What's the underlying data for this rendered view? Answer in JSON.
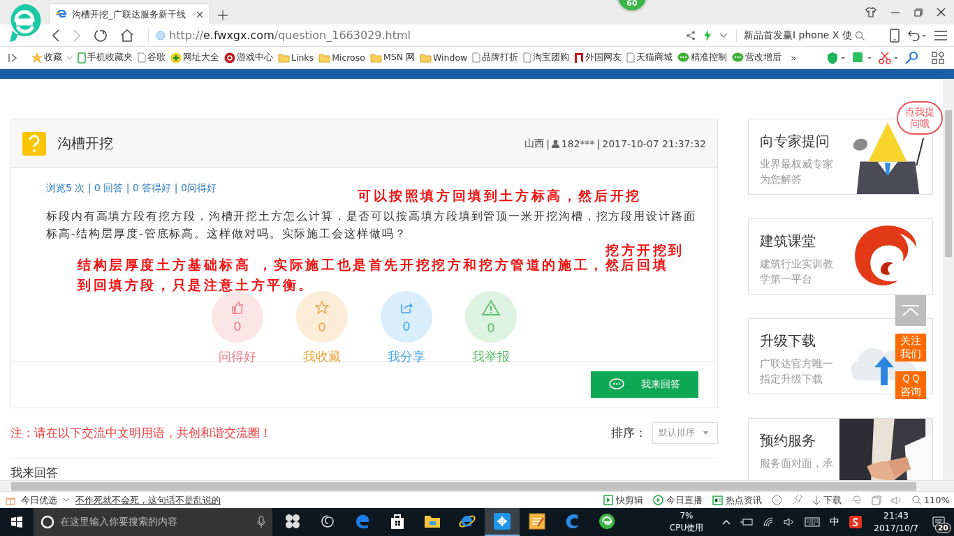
{
  "browser": {
    "tab_title": "沟槽开挖_广联达服务新干线",
    "badge": "60",
    "url": {
      "scheme": "http://",
      "host": "e.fwxgx.com",
      "path": "/question_1663029.html"
    },
    "search": "新品首发赢I phone X 使",
    "bookmarks": [
      {
        "kind": "star",
        "label": "收藏"
      },
      {
        "kind": "phone",
        "label": "手机收藏夹"
      },
      {
        "kind": "page",
        "label": "谷歌"
      },
      {
        "kind": "plus",
        "label": "网址大全"
      },
      {
        "kind": "game",
        "label": "游戏中心"
      },
      {
        "kind": "folder",
        "label": "Links"
      },
      {
        "kind": "folder",
        "label": "Microso"
      },
      {
        "kind": "folder",
        "label": "MSN 网"
      },
      {
        "kind": "folder",
        "label": "Window"
      },
      {
        "kind": "page",
        "label": "品牌打折"
      },
      {
        "kind": "page",
        "label": "淘宝团购"
      },
      {
        "kind": "flag",
        "label": "外国网友"
      },
      {
        "kind": "page",
        "label": "天猫商城"
      },
      {
        "kind": "chat",
        "label": "精准控制"
      },
      {
        "kind": "chat",
        "label": "营改增后"
      }
    ],
    "more": "»"
  },
  "question": {
    "title": "沟槽开挖",
    "meta": [
      {
        "kind": "location",
        "text": "山西"
      },
      {
        "kind": "sep",
        "text": "|"
      },
      {
        "kind": "user",
        "text": "182***"
      },
      {
        "kind": "sep",
        "text": "|"
      },
      {
        "kind": "time",
        "text": "2017-10-07 21:37:32"
      }
    ],
    "stats": "浏览5 次 | 0 回答 | 0 答得好 | 0问得好",
    "body": "标段内有高填方段有挖方段，沟槽开挖土方怎么计算，是否可以按高填方段填到管顶一米开挖沟槽，挖方段用设计路面标高-结构层厚度-管底标高。这样做对吗。实际施工会这样做吗？",
    "actions": [
      {
        "kind": "like",
        "count": "0",
        "label": "问得好",
        "color": "#f27c85"
      },
      {
        "kind": "star",
        "count": "0",
        "label": "我收藏",
        "color": "#e9a53d"
      },
      {
        "kind": "share",
        "count": "0",
        "label": "我分享",
        "color": "#42a7e8"
      },
      {
        "kind": "report",
        "count": "0",
        "label": "我举报",
        "color": "#5cbf6b"
      }
    ],
    "answer_button": "我来回答"
  },
  "annotations": [
    "可以按照填方回填到土方标高，然后开挖",
    "挖方开挖到",
    "结构层厚度土方基础标高 ，实际施工也是首先开挖挖方和挖方管道的施工，然后回填",
    "到回填方段，只是注意土方平衡。"
  ],
  "notice": "注：请在以下交流中文明用语，共创和谐交流圈！",
  "sort": {
    "label": "排序：",
    "value": "默认排序"
  },
  "answers_heading": "我来回答",
  "sidebar": [
    {
      "kind": "expert",
      "title": "向专家提问",
      "subtitle": "业界最权威专家为您解答"
    },
    {
      "kind": "course",
      "title": "建筑课堂",
      "subtitle": "建筑行业实训教学第一平台"
    },
    {
      "kind": "download",
      "title": "升级下载",
      "subtitle": "广联达官方唯一指定升级下载"
    },
    {
      "kind": "service",
      "title": "预约服务",
      "subtitle": "服务面对面，承"
    }
  ],
  "bubble": "点我提问哦",
  "float_buttons": [
    "关注我们",
    "ＱＱ咨询"
  ],
  "status_bar": {
    "left": "今日优选",
    "link": "不作死就不会死，这句话不是乱说的",
    "items": [
      {
        "kind": "clip",
        "label": "快剪辑"
      },
      {
        "kind": "live",
        "label": "今日直播"
      },
      {
        "kind": "news",
        "label": "热点资讯"
      }
    ],
    "download": "下载",
    "zoom": "110%"
  },
  "taskbar": {
    "search": "在这里输入你要搜索的内容",
    "apps": [
      {
        "kind": "pinwheel",
        "selected": false
      },
      {
        "kind": "swirl",
        "selected": false
      },
      {
        "kind": "edge",
        "selected": false
      },
      {
        "kind": "store",
        "selected": false
      },
      {
        "kind": "folder",
        "selected": false
      },
      {
        "kind": "ie",
        "selected": false
      },
      {
        "kind": "blue",
        "selected": true
      },
      {
        "kind": "notes",
        "selected": false
      },
      {
        "kind": "bluebird",
        "selected": false
      },
      {
        "kind": "greene",
        "selected": false
      }
    ],
    "cpu": "7%",
    "cpu_label": "CPU使用",
    "ime": "中",
    "time": "21:43",
    "date": "2017/10/7",
    "notifications": "20"
  }
}
